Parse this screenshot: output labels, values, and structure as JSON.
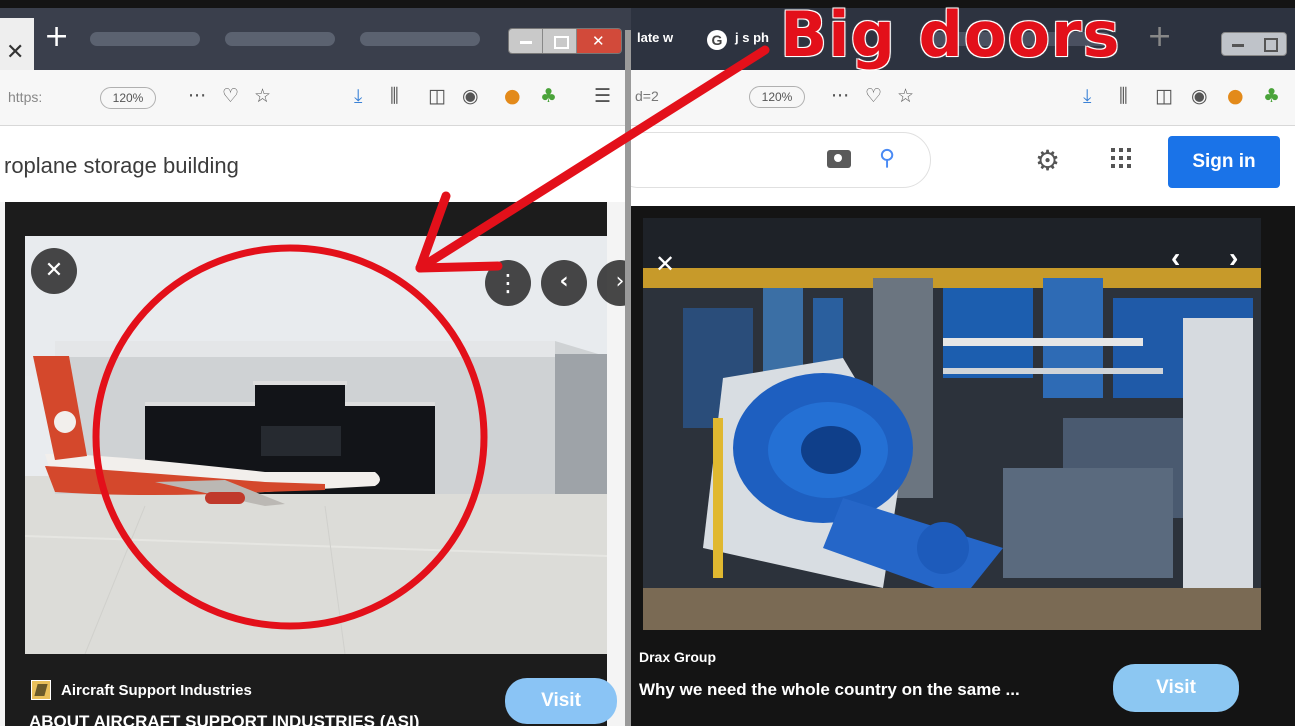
{
  "annotation": {
    "label": "Big doors",
    "colors": {
      "ink": "#e3101a"
    }
  },
  "left_window": {
    "toolbar": {
      "url": "https:",
      "zoom": "120%",
      "icons": [
        "more-icon",
        "pocket-icon",
        "star-icon",
        "download-icon",
        "library-icon",
        "sidebar-icon",
        "account-icon",
        "extension-icon",
        "addon-icon",
        "menu-icon"
      ]
    },
    "search": {
      "query": "roplane storage building"
    },
    "viewer": {
      "source": "Aircraft Support Industries",
      "title": "ABOUT AIRCRAFT SUPPORT INDUSTRIES (ASI)",
      "visit_label": "Visit"
    }
  },
  "right_window": {
    "tabs": [
      {
        "label": "late w"
      },
      {
        "label": "j s ph"
      }
    ],
    "toolbar": {
      "url": "d=2",
      "zoom": "120%"
    },
    "header": {
      "sign_in_label": "Sign in",
      "colors": {
        "sign_in": "#1a73e8"
      }
    },
    "viewer": {
      "source": "Drax Group",
      "title": "Why we need the whole country on the same ...",
      "visit_label": "Visit"
    }
  }
}
